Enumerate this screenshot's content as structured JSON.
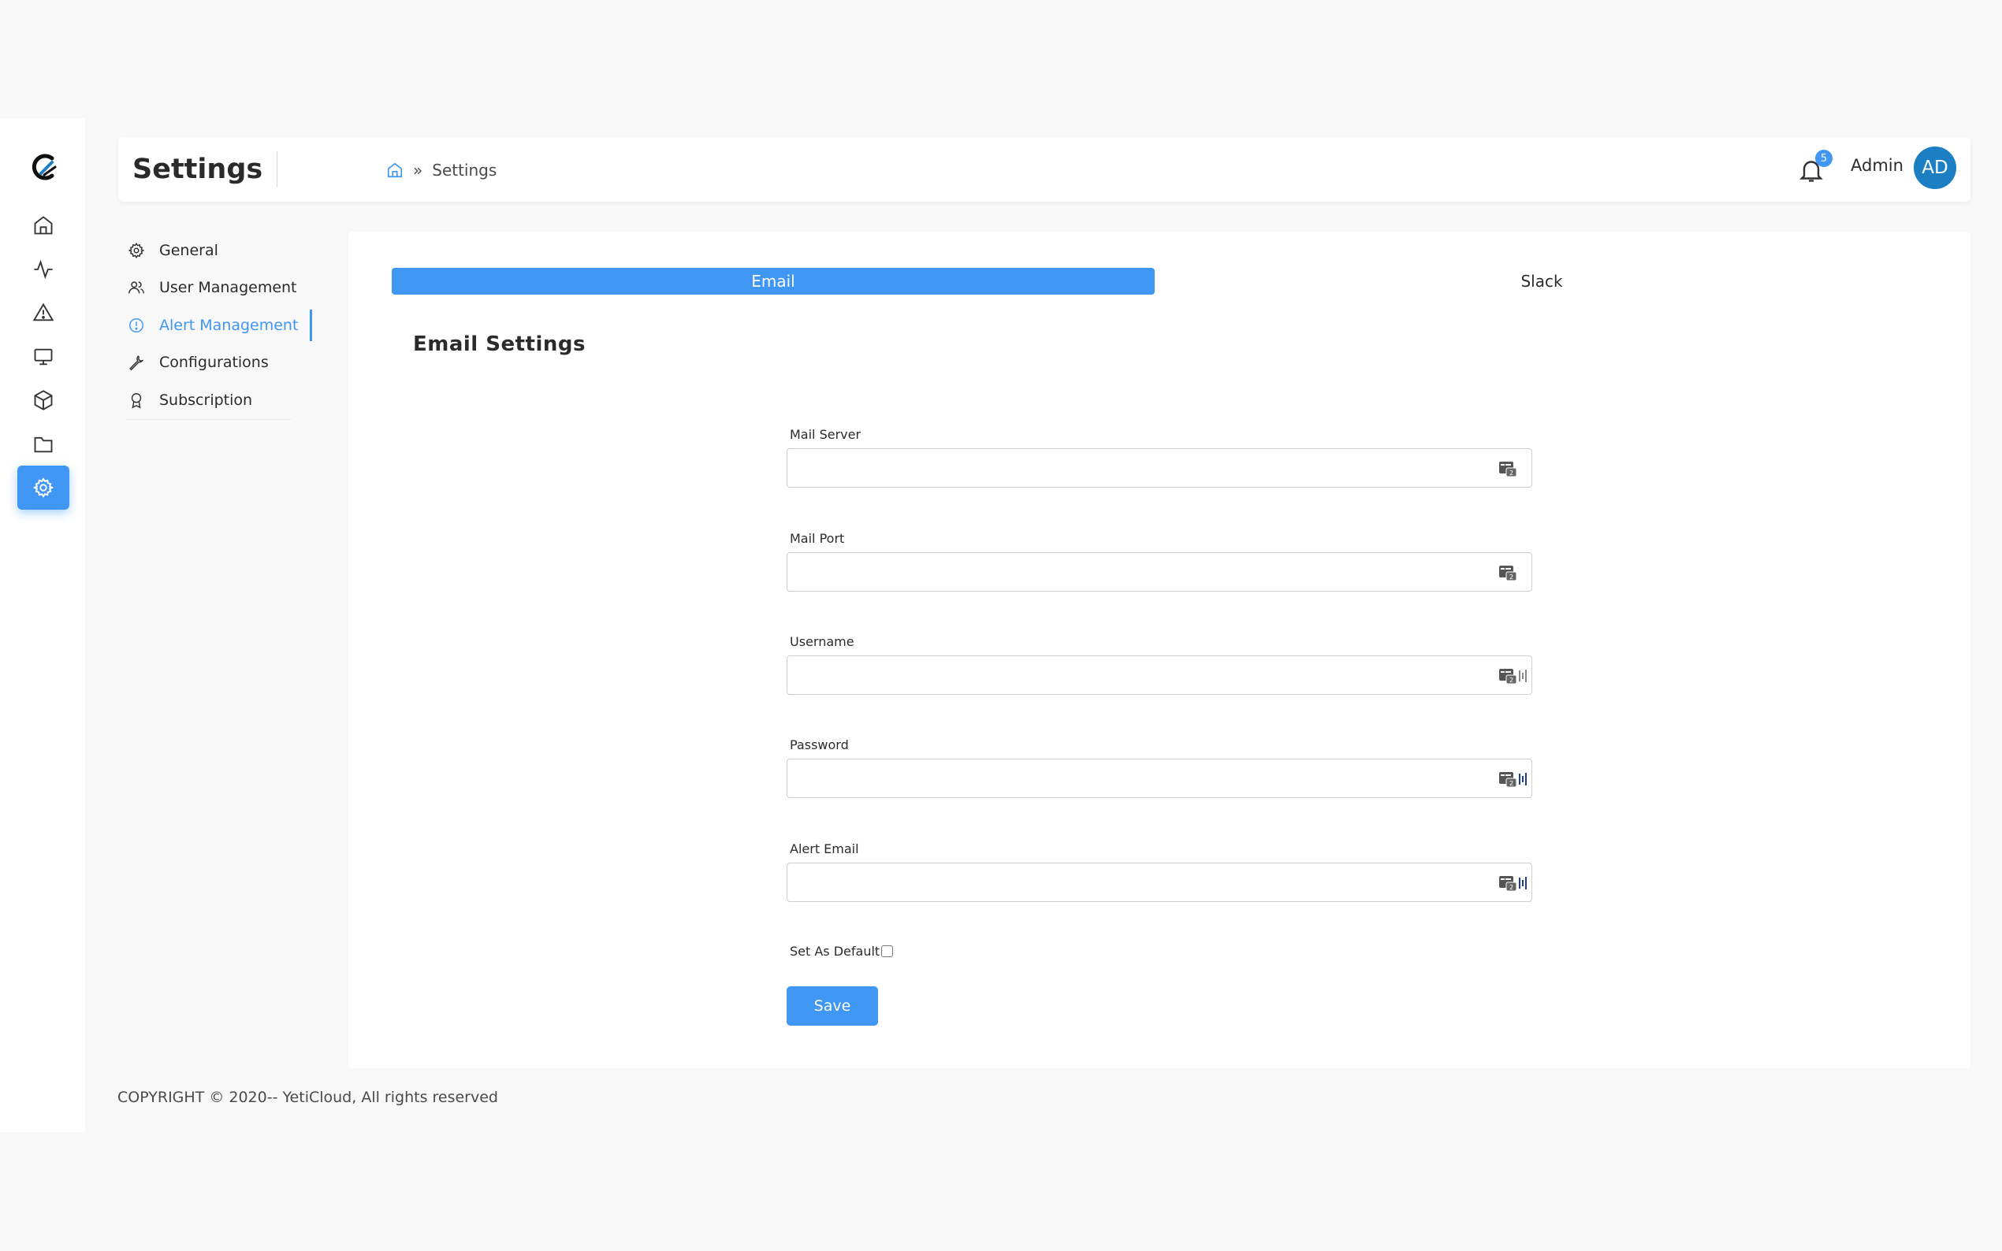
{
  "header": {
    "title": "Settings",
    "breadcrumb_sep": "»",
    "breadcrumb_current": "Settings",
    "notification_count": "5",
    "user_name": "Admin",
    "avatar_initials": "AD"
  },
  "rail": {
    "items": [
      "home-icon",
      "activity-icon",
      "alert-icon",
      "monitor-icon",
      "box-icon",
      "folder-icon",
      "settings-icon"
    ],
    "active": "settings-icon"
  },
  "settings_nav": {
    "items": [
      {
        "label": "General",
        "icon": "gear-icon"
      },
      {
        "label": "User Management",
        "icon": "users-icon"
      },
      {
        "label": "Alert Management",
        "icon": "info-circle-icon",
        "active": true
      },
      {
        "label": "Configurations",
        "icon": "wrench-icon"
      },
      {
        "label": "Subscription",
        "icon": "award-icon"
      }
    ]
  },
  "tabs": {
    "email": "Email",
    "slack": "Slack"
  },
  "section_title": "Email Settings",
  "fields": {
    "mail_server": {
      "label": "Mail Server",
      "value": ""
    },
    "mail_port": {
      "label": "Mail Port",
      "value": ""
    },
    "username": {
      "label": "Username",
      "value": ""
    },
    "password": {
      "label": "Password",
      "value": ""
    },
    "alert_email": {
      "label": "Alert Email",
      "value": ""
    }
  },
  "set_default_label": "Set As Default",
  "save_label": "Save",
  "footer": "COPYRIGHT © 2020-- YetiCloud, All rights reserved",
  "colors": {
    "accent": "#4096f3",
    "avatar": "#1c7fc4"
  }
}
